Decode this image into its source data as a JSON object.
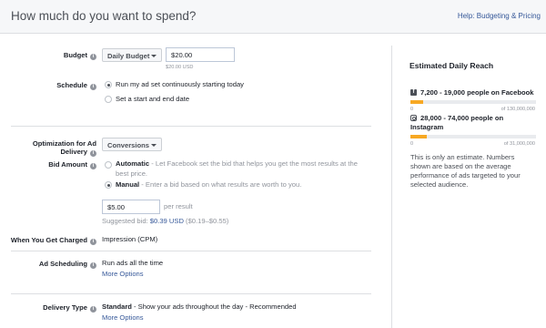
{
  "header": {
    "title": "How much do you want to spend?",
    "help_link": "Help: Budgeting & Pricing"
  },
  "budget": {
    "label": "Budget",
    "type_value": "Daily Budget",
    "amount_value": "$20.00",
    "amount_note": "$20.00 USD"
  },
  "schedule": {
    "label": "Schedule",
    "options": [
      {
        "label": "Run my ad set continuously starting today",
        "selected": true
      },
      {
        "label": "Set a start and end date",
        "selected": false
      }
    ]
  },
  "optimization": {
    "label_line1": "Optimization for Ad",
    "label_line2": "Delivery",
    "value": "Conversions"
  },
  "bid_amount": {
    "label": "Bid Amount",
    "automatic_title": "Automatic",
    "automatic_desc": " - Let Facebook set the bid that helps you get the most results at the",
    "automatic_desc_line2": "best price.",
    "manual_title": "Manual",
    "manual_desc": " - Enter a bid based on what results are worth to you.",
    "bid_value": "$5.00",
    "per_result": "per result",
    "suggested_prefix": "Suggested bid: ",
    "suggested_value": "$0.39 USD",
    "suggested_range": " ($0.19–$0.55)"
  },
  "charged": {
    "label": "When You Get Charged",
    "value": "Impression (CPM)"
  },
  "ad_scheduling": {
    "label": "Ad Scheduling",
    "value": "Run ads all the time",
    "more": "More Options"
  },
  "delivery_type": {
    "label": "Delivery Type",
    "value_bold": "Standard",
    "value_rest": " - Show your ads throughout the day - Recommended",
    "more": "More Options"
  },
  "reach": {
    "title": "Estimated Daily Reach",
    "facebook": {
      "text": "7,200 - 19,000 people on Facebook",
      "min": "0",
      "max": "of 130,000,000",
      "fill_fraction": 0.1
    },
    "instagram": {
      "text_line1": "28,000 - 74,000 people on",
      "text_line2": "Instagram",
      "min": "0",
      "max": "of 31,000,000",
      "fill_fraction": 0.13
    },
    "disclaimer": [
      "This is only an estimate. Numbers",
      "shown are based on the average",
      "performance of ads targeted to your",
      "selected audience."
    ]
  },
  "colors": {
    "accent_link": "#365899",
    "bar_fill": "#f7a823",
    "bar_track": "#e9ebee"
  },
  "icons": [
    "help-icon",
    "caret-down-icon",
    "facebook-icon",
    "instagram-icon",
    "radio-icon"
  ]
}
